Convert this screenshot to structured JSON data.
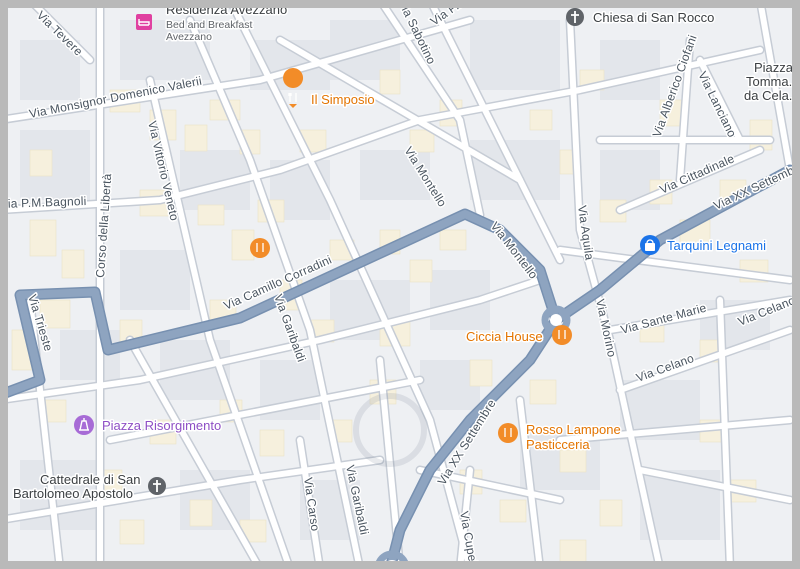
{
  "roads": {
    "tevere": "Via Tevere",
    "monsignor": "Via Monsignor Domenico Valerii",
    "pm_bagnoli": "Via P.M.Bagnoli",
    "corso_liberta": "Corso della Libertà",
    "vittorio_veneto": "Via Vittorio Veneto",
    "trieste": "Via Trieste",
    "camillo": "Via Camillo Corradini",
    "garibaldi_1": "Via Garibaldi",
    "garibaldi_2": "Via Garibaldi",
    "montello_1": "Via Montello",
    "montello_2": "Via Montello",
    "sabotino": "Via Sabotino",
    "pm_top": "Via P.M...",
    "aquila": "Via Aquila",
    "morino": "Via Morino",
    "alberico": "Via Alberico Ciofani",
    "lanciano": "Via Lanciano",
    "cittadinale": "Via Cittadinale",
    "xx_settembre_1": "Via XX Settembre",
    "xx_settembre_2": "Via XX Settembre",
    "sante_marie": "Via Sante Marie",
    "celano_1": "Via Celano",
    "celano_2": "Via Celano",
    "carso": "Via Carso",
    "cupello": "Via Cupello"
  },
  "pois": {
    "residenza": {
      "name": "Residenza Avezzano",
      "sub1": "Bed and Breakfast",
      "sub2": "Avezzano",
      "icon": "bed-icon"
    },
    "chiesa_rocco": {
      "name": "Chiesa di San Rocco",
      "icon": "church-icon"
    },
    "piazza_tommaso": {
      "line1": "Piazza",
      "line2": "Tomma...",
      "line3": "da Cela..."
    },
    "simposio": {
      "name": "Il Simposio",
      "icon": "restaurant-icon"
    },
    "tarquini": {
      "name": "Tarquini Legnami",
      "icon": "shopping-bag-icon"
    },
    "ciccia": {
      "name": "Ciccia House",
      "icon": "restaurant-icon"
    },
    "rosso": {
      "name": "Rosso Lampone",
      "name2": "Pasticceria",
      "icon": "restaurant-icon"
    },
    "risorgimento": {
      "name": "Piazza Risorgimento",
      "icon": "monument-icon"
    },
    "cattedrale": {
      "name": "Cattedrale di San",
      "name2": "Bartolomeo Apostolo",
      "icon": "church-icon"
    }
  },
  "colors": {
    "land": "#eef0f3",
    "block": "#e2e5ea",
    "building": "#f6f0dd",
    "road": "#ffffff",
    "road_edge": "#c6ccd5",
    "major_road": "#8ea4c0",
    "restaurant": "#e37400",
    "monument": "#a76bd6",
    "shop": "#1a73e8",
    "frame": "#b9b9b9"
  }
}
